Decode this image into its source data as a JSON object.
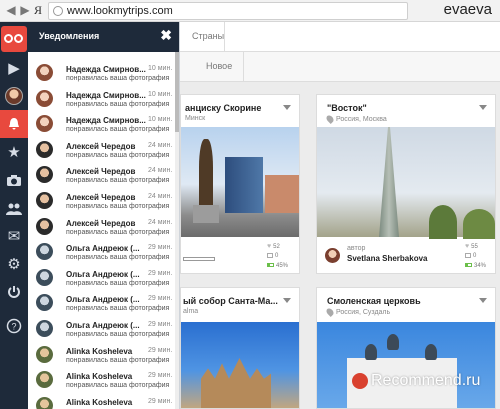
{
  "browser": {
    "back": "◀",
    "forward": "▶",
    "ya": "Я",
    "url": "www.lookmytrips.com",
    "brand": "evaeva"
  },
  "rail": {
    "items": [
      {
        "icon": "play-icon",
        "glyph": "▶"
      },
      {
        "icon": "user-avatar",
        "glyph": ""
      },
      {
        "icon": "bell-icon",
        "glyph": "🔔"
      },
      {
        "icon": "star-icon",
        "glyph": "★"
      },
      {
        "icon": "camera-icon",
        "glyph": "📷"
      },
      {
        "icon": "people-icon",
        "glyph": "👥"
      },
      {
        "icon": "mail-icon",
        "glyph": "✉"
      },
      {
        "icon": "gear-icon",
        "glyph": "⚙"
      },
      {
        "icon": "power-icon",
        "glyph": "⏻"
      },
      {
        "icon": "help-icon",
        "glyph": "?"
      }
    ]
  },
  "notifications": {
    "title": "Уведомления",
    "close": "✖",
    "items": [
      {
        "name": "Надежда Смирнов...",
        "time": "10 мин.",
        "text": "понравилась ваша фотография"
      },
      {
        "name": "Надежда Смирнов...",
        "time": "10 мин.",
        "text": "понравилась ваша фотография"
      },
      {
        "name": "Надежда Смирнов...",
        "time": "10 мин.",
        "text": "понравилась ваша фотография"
      },
      {
        "name": "Алексей Чередов",
        "time": "24 мин.",
        "text": "понравилась ваша фотография"
      },
      {
        "name": "Алексей Чередов",
        "time": "24 мин.",
        "text": "понравилась ваша фотография"
      },
      {
        "name": "Алексей Чередов",
        "time": "24 мин.",
        "text": "понравилась ваша фотография"
      },
      {
        "name": "Алексей Чередов",
        "time": "24 мин.",
        "text": "понравилась ваша фотография"
      },
      {
        "name": "Ольга Андреюк (...",
        "time": "29 мин.",
        "text": "понравилась ваша фотография"
      },
      {
        "name": "Ольга Андреюк (...",
        "time": "29 мин.",
        "text": "понравилась ваша фотография"
      },
      {
        "name": "Ольга Андреюк (...",
        "time": "29 мин.",
        "text": "понравилась ваша фотография"
      },
      {
        "name": "Ольга Андреюк (...",
        "time": "29 мин.",
        "text": "понравилась ваша фотография"
      },
      {
        "name": "Alinka Kosheleva",
        "time": "29 мин.",
        "text": "понравилась ваша фотография"
      },
      {
        "name": "Alinka Kosheleva",
        "time": "29 мин.",
        "text": "понравилась ваша фотография"
      },
      {
        "name": "Alinka Kosheleva",
        "time": "29 мин.",
        "text": ""
      }
    ]
  },
  "main": {
    "top_tab": "Страны",
    "sub_tab": "Новое",
    "cards": [
      {
        "title": "анциску Скорине",
        "location": "Минск",
        "likes": "52",
        "comments": "0",
        "percent": "45%"
      },
      {
        "title": "\"Восток\"",
        "location": "Россия, Москва",
        "author_role": "автор",
        "author": "Svetlana Sherbakova",
        "likes": "55",
        "comments": "0",
        "percent": "34%"
      },
      {
        "title": "ый собор Санта-Ма...",
        "location": "alma"
      },
      {
        "title": "Смоленская церковь",
        "location": "Россия, Суздаль"
      }
    ]
  },
  "watermark": "Recommend.ru",
  "colors": {
    "accent": "#e8493e",
    "rail": "#1e2a3a"
  }
}
